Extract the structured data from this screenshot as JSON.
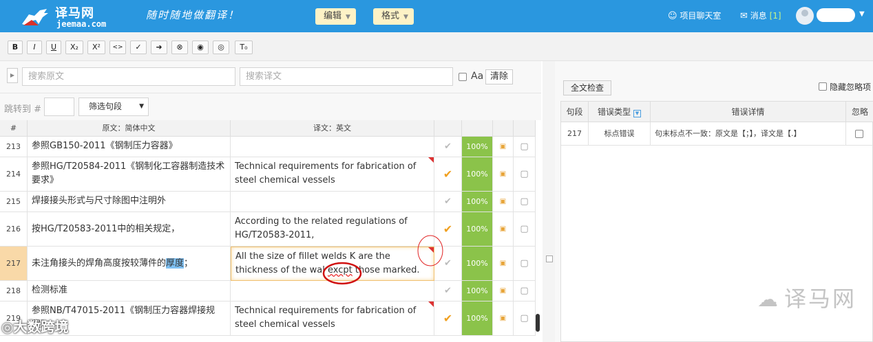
{
  "header": {
    "logo_cn": "译马网",
    "logo_en": "jeemaa.com",
    "slogan": "随时随地做翻译！",
    "menu_edit": "编辑",
    "menu_format": "格式",
    "chat_label": "项目聊天室",
    "msg_label": "消息",
    "msg_count": "[1]"
  },
  "toolbar": {
    "buttons": [
      "B",
      "I",
      "U",
      "X₂",
      "X²",
      "<>",
      "✓",
      "➜",
      "⊗",
      "◉",
      "◎",
      "T₀"
    ]
  },
  "search": {
    "source_placeholder": "搜索原文",
    "target_placeholder": "搜索译文",
    "case_label": "Aa",
    "clear_label": "清除"
  },
  "filter": {
    "jump_label": "跳转到 #",
    "filter_label": "筛选句段"
  },
  "grid": {
    "col_num": "#",
    "col_source": "原文：简体中文",
    "col_target": "译文：英文",
    "rows": [
      {
        "num": "213",
        "source": "参照GB150-2011《钢制压力容器》",
        "target": "",
        "pct": "100%"
      },
      {
        "num": "214",
        "source": "参照HG/T20584-2011《钢制化工容器制造技术要求》",
        "target": "Technical requirements for fabrication of steel chemical vessels",
        "pct": "100%"
      },
      {
        "num": "215",
        "source": "焊接接头形式与尺寸除图中注明外",
        "target": "",
        "pct": "100%"
      },
      {
        "num": "216",
        "source": "按HG/T20583-2011中的相关规定，",
        "target": "According to the related regulations of HG/T20583-2011,",
        "pct": "100%"
      },
      {
        "num": "217",
        "source_pre": "未注角接头的焊角高度按较薄件的",
        "source_hl": "厚度",
        "source_post": "；",
        "target_pre": "All the size of fillet welds K are the thickness of the wal ",
        "target_err": "excpt",
        "target_post": " those marked.",
        "pct": "100%"
      },
      {
        "num": "218",
        "source": "检测标准",
        "target": "",
        "pct": "100%"
      },
      {
        "num": "219",
        "source": "参照NB/T47015-2011《钢制压力容器焊接规程》",
        "target": "Technical requirements for fabrication of steel chemical vessels",
        "pct": "100%"
      }
    ]
  },
  "check": {
    "full_check": "全文检查",
    "hide_ignored": "隐藏忽略项",
    "col_seg": "句段",
    "col_type": "错误类型",
    "col_detail": "错误详情",
    "col_ignore": "忽略",
    "row_seg": "217",
    "row_type": "标点错误",
    "row_detail": "句末标点不一致：原文是【；】，译文是【.】"
  },
  "watermarks": {
    "right": "译马网",
    "left": "大数跨境"
  }
}
